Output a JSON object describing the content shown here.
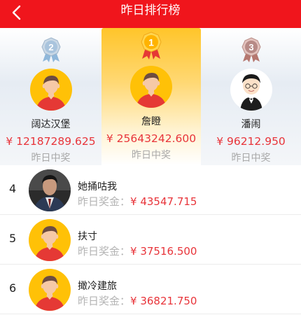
{
  "header": {
    "title": "昨日排行榜",
    "back_icon": "chevron-left-icon"
  },
  "podium": {
    "second": {
      "medal": "2",
      "name": "阔达汉堡",
      "amount": "¥ 12187289.625",
      "sub": "昨日中奖"
    },
    "first": {
      "medal": "1",
      "name": "詹瞪",
      "amount": "¥ 25643242.600",
      "sub": "昨日中奖"
    },
    "third": {
      "medal": "3",
      "name": "潘闹",
      "amount": "¥ 96212.950",
      "sub": "昨日中奖"
    }
  },
  "list": {
    "prize_label": "昨日奖金：",
    "rows": [
      {
        "rank": "4",
        "name": "她捅咕我",
        "amount": "¥ 43547.715"
      },
      {
        "rank": "5",
        "name": "扶寸",
        "amount": "¥ 37516.500"
      },
      {
        "rank": "6",
        "name": "撖冷建旅",
        "amount": "¥ 36821.750"
      }
    ]
  },
  "colors": {
    "header_bg": "#f0151c",
    "amount_red": "#e8343a",
    "gold": "#ffc52a",
    "silver_medal": "#a9c4dd",
    "bronze_medal": "#b78a86"
  }
}
